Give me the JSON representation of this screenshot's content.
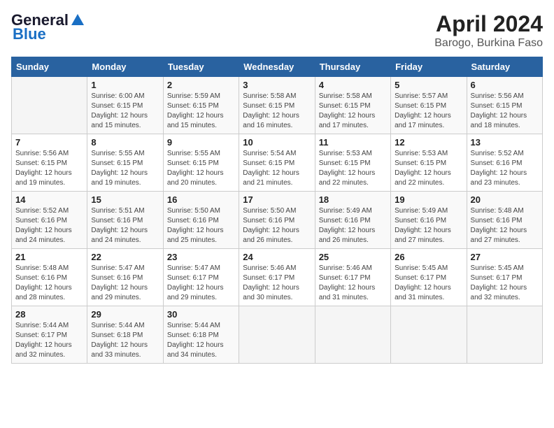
{
  "logo": {
    "general": "General",
    "blue": "Blue"
  },
  "header": {
    "month": "April 2024",
    "location": "Barogo, Burkina Faso"
  },
  "days_of_week": [
    "Sunday",
    "Monday",
    "Tuesday",
    "Wednesday",
    "Thursday",
    "Friday",
    "Saturday"
  ],
  "weeks": [
    [
      {
        "day": "",
        "info": ""
      },
      {
        "day": "1",
        "info": "Sunrise: 6:00 AM\nSunset: 6:15 PM\nDaylight: 12 hours\nand 15 minutes."
      },
      {
        "day": "2",
        "info": "Sunrise: 5:59 AM\nSunset: 6:15 PM\nDaylight: 12 hours\nand 15 minutes."
      },
      {
        "day": "3",
        "info": "Sunrise: 5:58 AM\nSunset: 6:15 PM\nDaylight: 12 hours\nand 16 minutes."
      },
      {
        "day": "4",
        "info": "Sunrise: 5:58 AM\nSunset: 6:15 PM\nDaylight: 12 hours\nand 17 minutes."
      },
      {
        "day": "5",
        "info": "Sunrise: 5:57 AM\nSunset: 6:15 PM\nDaylight: 12 hours\nand 17 minutes."
      },
      {
        "day": "6",
        "info": "Sunrise: 5:56 AM\nSunset: 6:15 PM\nDaylight: 12 hours\nand 18 minutes."
      }
    ],
    [
      {
        "day": "7",
        "info": "Sunrise: 5:56 AM\nSunset: 6:15 PM\nDaylight: 12 hours\nand 19 minutes."
      },
      {
        "day": "8",
        "info": "Sunrise: 5:55 AM\nSunset: 6:15 PM\nDaylight: 12 hours\nand 19 minutes."
      },
      {
        "day": "9",
        "info": "Sunrise: 5:55 AM\nSunset: 6:15 PM\nDaylight: 12 hours\nand 20 minutes."
      },
      {
        "day": "10",
        "info": "Sunrise: 5:54 AM\nSunset: 6:15 PM\nDaylight: 12 hours\nand 21 minutes."
      },
      {
        "day": "11",
        "info": "Sunrise: 5:53 AM\nSunset: 6:15 PM\nDaylight: 12 hours\nand 22 minutes."
      },
      {
        "day": "12",
        "info": "Sunrise: 5:53 AM\nSunset: 6:15 PM\nDaylight: 12 hours\nand 22 minutes."
      },
      {
        "day": "13",
        "info": "Sunrise: 5:52 AM\nSunset: 6:16 PM\nDaylight: 12 hours\nand 23 minutes."
      }
    ],
    [
      {
        "day": "14",
        "info": "Sunrise: 5:52 AM\nSunset: 6:16 PM\nDaylight: 12 hours\nand 24 minutes."
      },
      {
        "day": "15",
        "info": "Sunrise: 5:51 AM\nSunset: 6:16 PM\nDaylight: 12 hours\nand 24 minutes."
      },
      {
        "day": "16",
        "info": "Sunrise: 5:50 AM\nSunset: 6:16 PM\nDaylight: 12 hours\nand 25 minutes."
      },
      {
        "day": "17",
        "info": "Sunrise: 5:50 AM\nSunset: 6:16 PM\nDaylight: 12 hours\nand 26 minutes."
      },
      {
        "day": "18",
        "info": "Sunrise: 5:49 AM\nSunset: 6:16 PM\nDaylight: 12 hours\nand 26 minutes."
      },
      {
        "day": "19",
        "info": "Sunrise: 5:49 AM\nSunset: 6:16 PM\nDaylight: 12 hours\nand 27 minutes."
      },
      {
        "day": "20",
        "info": "Sunrise: 5:48 AM\nSunset: 6:16 PM\nDaylight: 12 hours\nand 27 minutes."
      }
    ],
    [
      {
        "day": "21",
        "info": "Sunrise: 5:48 AM\nSunset: 6:16 PM\nDaylight: 12 hours\nand 28 minutes."
      },
      {
        "day": "22",
        "info": "Sunrise: 5:47 AM\nSunset: 6:16 PM\nDaylight: 12 hours\nand 29 minutes."
      },
      {
        "day": "23",
        "info": "Sunrise: 5:47 AM\nSunset: 6:17 PM\nDaylight: 12 hours\nand 29 minutes."
      },
      {
        "day": "24",
        "info": "Sunrise: 5:46 AM\nSunset: 6:17 PM\nDaylight: 12 hours\nand 30 minutes."
      },
      {
        "day": "25",
        "info": "Sunrise: 5:46 AM\nSunset: 6:17 PM\nDaylight: 12 hours\nand 31 minutes."
      },
      {
        "day": "26",
        "info": "Sunrise: 5:45 AM\nSunset: 6:17 PM\nDaylight: 12 hours\nand 31 minutes."
      },
      {
        "day": "27",
        "info": "Sunrise: 5:45 AM\nSunset: 6:17 PM\nDaylight: 12 hours\nand 32 minutes."
      }
    ],
    [
      {
        "day": "28",
        "info": "Sunrise: 5:44 AM\nSunset: 6:17 PM\nDaylight: 12 hours\nand 32 minutes."
      },
      {
        "day": "29",
        "info": "Sunrise: 5:44 AM\nSunset: 6:18 PM\nDaylight: 12 hours\nand 33 minutes."
      },
      {
        "day": "30",
        "info": "Sunrise: 5:44 AM\nSunset: 6:18 PM\nDaylight: 12 hours\nand 34 minutes."
      },
      {
        "day": "",
        "info": ""
      },
      {
        "day": "",
        "info": ""
      },
      {
        "day": "",
        "info": ""
      },
      {
        "day": "",
        "info": ""
      }
    ]
  ]
}
